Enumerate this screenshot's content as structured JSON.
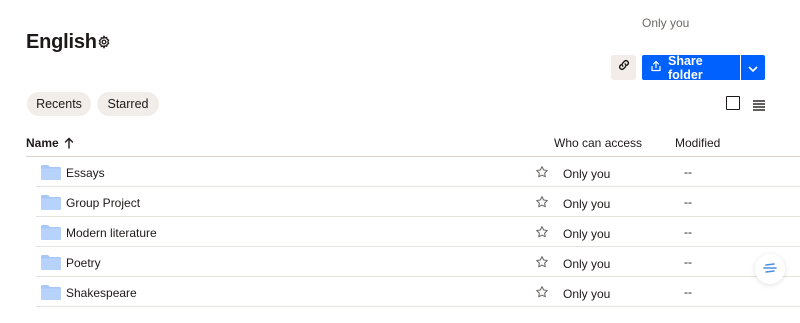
{
  "header": {
    "access_text": "Only you",
    "title": "English",
    "settings_icon": "gear-icon",
    "copy_link_icon": "link-icon",
    "share_label": "Share folder",
    "share_icon": "upload-icon",
    "share_menu_icon": "chevron-down-icon"
  },
  "filters": {
    "recents_label": "Recents",
    "starred_label": "Starred"
  },
  "view_controls": {
    "grid_icon": "grid-view-icon",
    "list_icon": "list-view-icon"
  },
  "table": {
    "columns": {
      "name": "Name",
      "access": "Who can access",
      "modified": "Modified"
    },
    "sort": "ascending",
    "rows": [
      {
        "name": "Essays",
        "access": "Only you",
        "modified": "--"
      },
      {
        "name": "Group Project",
        "access": "Only you",
        "modified": "--"
      },
      {
        "name": "Modern literature",
        "access": "Only you",
        "modified": "--"
      },
      {
        "name": "Poetry",
        "access": "Only you",
        "modified": "--"
      },
      {
        "name": "Shakespeare",
        "access": "Only you",
        "modified": "--"
      }
    ]
  },
  "colors": {
    "accent": "#0061fe",
    "pill_bg": "#f2ede8",
    "folder": "#a8c8f8",
    "text": "#1e1919"
  },
  "fab_icon": "help-icon"
}
